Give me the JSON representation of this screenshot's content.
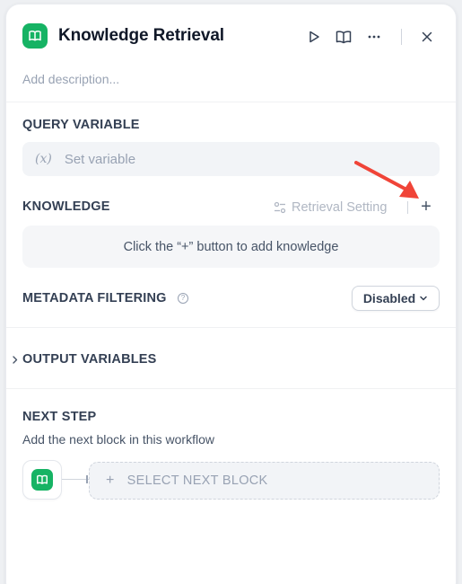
{
  "header": {
    "title": "Knowledge Retrieval",
    "description_placeholder": "Add description...",
    "icons": [
      "book-icon",
      "play-icon",
      "docs-icon",
      "more-icon",
      "close-icon"
    ]
  },
  "query_variable": {
    "label": "QUERY VARIABLE",
    "prefix": "(x)",
    "placeholder": "Set variable"
  },
  "knowledge": {
    "label": "KNOWLEDGE",
    "retrieval_setting": "Retrieval Setting",
    "add": "+",
    "empty_text": "Click the “+” button to add knowledge"
  },
  "metadata": {
    "label": "METADATA FILTERING",
    "help": "?",
    "value": "Disabled"
  },
  "output": {
    "label": "OUTPUT VARIABLES"
  },
  "next_step": {
    "label": "NEXT STEP",
    "description": "Add the next block in this workflow",
    "plus": "+",
    "select_label": "SELECT NEXT BLOCK"
  },
  "colors": {
    "accent": "#16b364",
    "annotation_arrow": "#f04438"
  }
}
